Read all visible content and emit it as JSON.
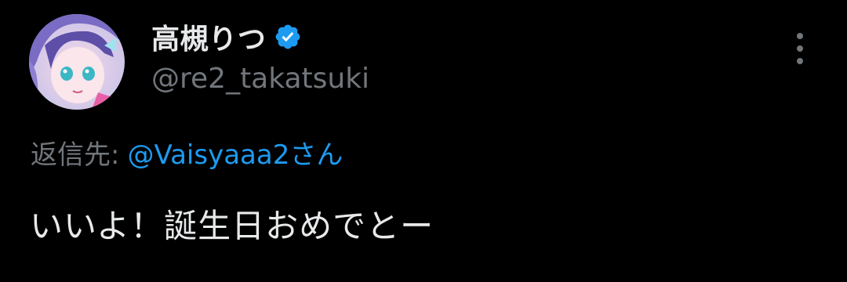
{
  "colors": {
    "background": "#000000",
    "primary_text": "#e7e9ea",
    "secondary_text": "#71767b",
    "accent": "#1d9bf0"
  },
  "author": {
    "display_name": "高槻りつ",
    "handle": "@re2_takatsuki",
    "verified_icon": "verified-badge-icon",
    "avatar_icon": "avatar-illustration"
  },
  "menu": {
    "icon": "more-options-icon"
  },
  "reply": {
    "label": "返信先:",
    "mention": "@Vaisyaaa2さん"
  },
  "tweet": {
    "text": "いいよ！誕生日おめでとー"
  }
}
